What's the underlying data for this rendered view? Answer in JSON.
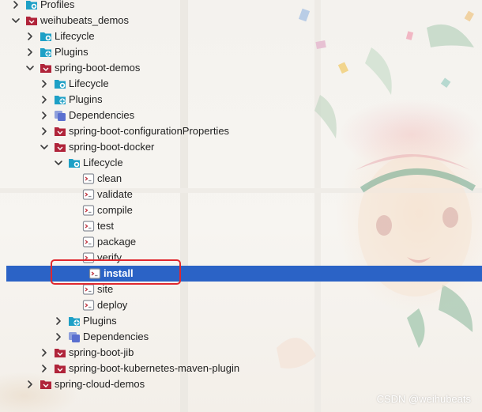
{
  "tree": {
    "rows": [
      {
        "label": "Profiles",
        "icon": "profiles-folder-icon",
        "expander": "right"
      },
      {
        "label": "weihubeats_demos",
        "icon": "maven-project-icon",
        "expander": "down"
      },
      {
        "label": "Lifecycle",
        "icon": "lifecycle-folder-icon",
        "expander": "right"
      },
      {
        "label": "Plugins",
        "icon": "plugins-folder-icon",
        "expander": "right"
      },
      {
        "label": "spring-boot-demos",
        "icon": "maven-project-icon",
        "expander": "down"
      },
      {
        "label": "Lifecycle",
        "icon": "lifecycle-folder-icon",
        "expander": "right"
      },
      {
        "label": "Plugins",
        "icon": "plugins-folder-icon",
        "expander": "right"
      },
      {
        "label": "Dependencies",
        "icon": "dependencies-folder-icon",
        "expander": "right"
      },
      {
        "label": "spring-boot-configurationProperties",
        "icon": "maven-project-icon",
        "expander": "right"
      },
      {
        "label": "spring-boot-docker",
        "icon": "maven-project-icon",
        "expander": "down"
      },
      {
        "label": "Lifecycle",
        "icon": "lifecycle-folder-icon",
        "expander": "down"
      },
      {
        "label": "clean",
        "icon": "lifecycle-goal-icon",
        "expander": "none"
      },
      {
        "label": "validate",
        "icon": "lifecycle-goal-icon",
        "expander": "none"
      },
      {
        "label": "compile",
        "icon": "lifecycle-goal-icon",
        "expander": "none"
      },
      {
        "label": "test",
        "icon": "lifecycle-goal-icon",
        "expander": "none"
      },
      {
        "label": "package",
        "icon": "lifecycle-goal-icon",
        "expander": "none"
      },
      {
        "label": "verify",
        "icon": "lifecycle-goal-icon",
        "expander": "none"
      },
      {
        "label": "install",
        "icon": "lifecycle-goal-icon",
        "expander": "none",
        "selected": true
      },
      {
        "label": "site",
        "icon": "lifecycle-goal-icon",
        "expander": "none"
      },
      {
        "label": "deploy",
        "icon": "lifecycle-goal-icon",
        "expander": "none"
      },
      {
        "label": "Plugins",
        "icon": "plugins-folder-icon",
        "expander": "right"
      },
      {
        "label": "Dependencies",
        "icon": "dependencies-folder-icon",
        "expander": "right"
      },
      {
        "label": "spring-boot-jib",
        "icon": "maven-project-icon",
        "expander": "right"
      },
      {
        "label": "spring-boot-kubernetes-maven-plugin",
        "icon": "maven-project-icon",
        "expander": "right"
      },
      {
        "label": "spring-cloud-demos",
        "icon": "maven-project-icon",
        "expander": "right"
      }
    ]
  },
  "watermark": {
    "text": "CSDN @weihubeats"
  },
  "colors": {
    "selection": "#2b63c6",
    "highlight_box": "#e0282e",
    "maven_icon": "#b0243a",
    "folder_teal": "#1ea0c6",
    "goal_icon": "#8a8f98"
  }
}
